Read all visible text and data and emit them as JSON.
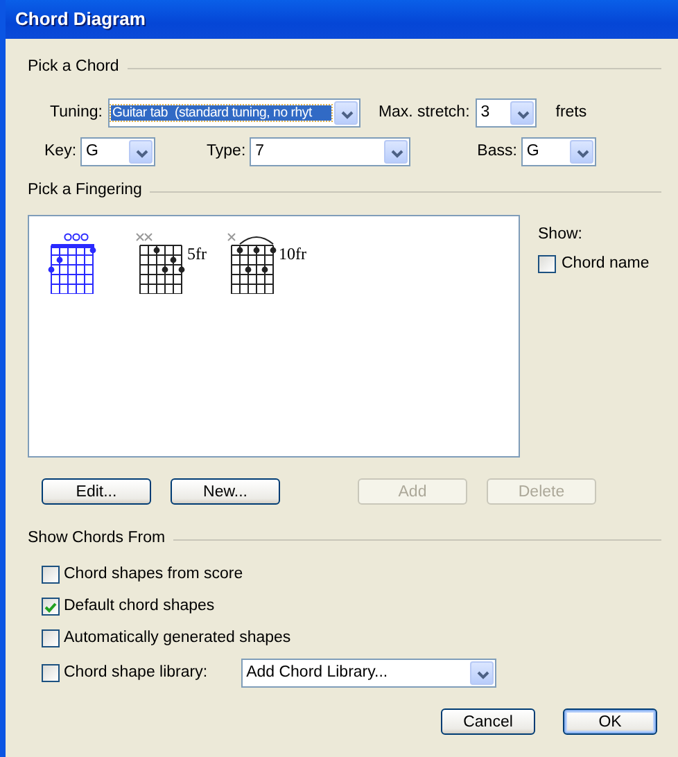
{
  "window": {
    "title": "Chord Diagram"
  },
  "pick_a_chord": {
    "heading": "Pick a Chord",
    "row_1": [
      {
        "label": "Tuning:",
        "value": "Guitar tab  (standard tuning, no rhyt",
        "highlighted": true
      },
      {
        "label": "Max. stretch:",
        "value": "3",
        "highlighted": false,
        "suffix": "frets"
      }
    ],
    "row_2": [
      {
        "label": "Key:",
        "value": "G",
        "highlighted": false
      },
      {
        "label": "Type:",
        "value": "7",
        "highlighted": false
      },
      {
        "label": "Bass:",
        "value": "G",
        "highlighted": false
      }
    ]
  },
  "pick_a_fingering": {
    "heading": "Pick a Fingering",
    "fingerings": [
      {
        "selected": true
      },
      {
        "selected": false,
        "fret_label": "5fr"
      },
      {
        "selected": false,
        "fret_label": "10fr"
      }
    ],
    "show_label": "Show:",
    "chord_name": {
      "label": "Chord name",
      "checked": false
    },
    "buttons": [
      {
        "label": "Edit...",
        "disabled": false
      },
      {
        "label": "New...",
        "disabled": false
      },
      {
        "label": "Add",
        "disabled": true
      },
      {
        "label": "Delete",
        "disabled": true
      }
    ]
  },
  "show_chords_from": {
    "heading": "Show Chords From",
    "options": [
      {
        "label": "Chord shapes from score",
        "checked": false
      },
      {
        "label": "Default chord shapes",
        "checked": true
      },
      {
        "label": "Automatically generated shapes",
        "checked": false
      },
      {
        "label": "Chord shape library:",
        "checked": false,
        "dropdown": "Add Chord Library..."
      }
    ]
  },
  "footer_buttons": [
    {
      "label": "Cancel",
      "default": false
    },
    {
      "label": "OK",
      "default": true
    }
  ]
}
